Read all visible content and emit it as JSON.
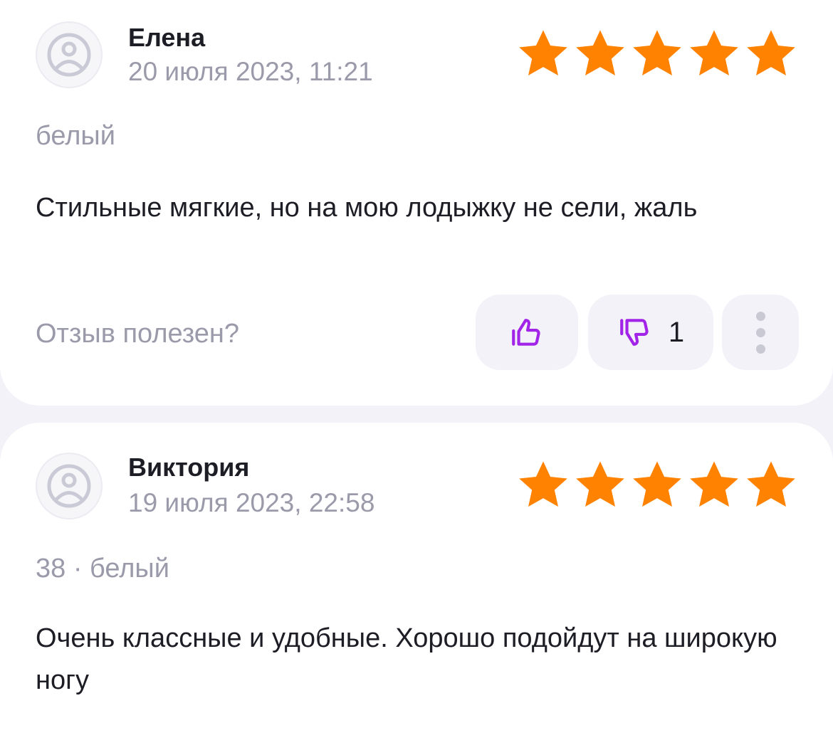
{
  "colors": {
    "background": "#f3f2f8",
    "card": "#ffffff",
    "star": "#ff8200",
    "vote_icon": "#a224e8",
    "muted_text": "#9a9aaa",
    "text": "#1d1d25"
  },
  "reviews": [
    {
      "author": "Елена",
      "date": "20 июля 2023, 11:21",
      "rating": 5,
      "variant": "белый",
      "text": "Стильные мягкие, но на мою лодыжку не сели, жаль",
      "helpful_label": "Отзыв полезен?",
      "dislike_count": "1",
      "avatar_icon": "sad-face-icon",
      "like_icon": "thumbs-up-icon",
      "dislike_icon": "thumbs-down-icon",
      "more_icon": "more-vertical-icon"
    },
    {
      "author": "Виктория",
      "date": "19 июля 2023, 22:58",
      "rating": 5,
      "variant": "38 · белый",
      "text": "Очень классные и удобные. Хорошо подойдут  на широкую ногу",
      "avatar_icon": "sad-face-icon"
    }
  ]
}
